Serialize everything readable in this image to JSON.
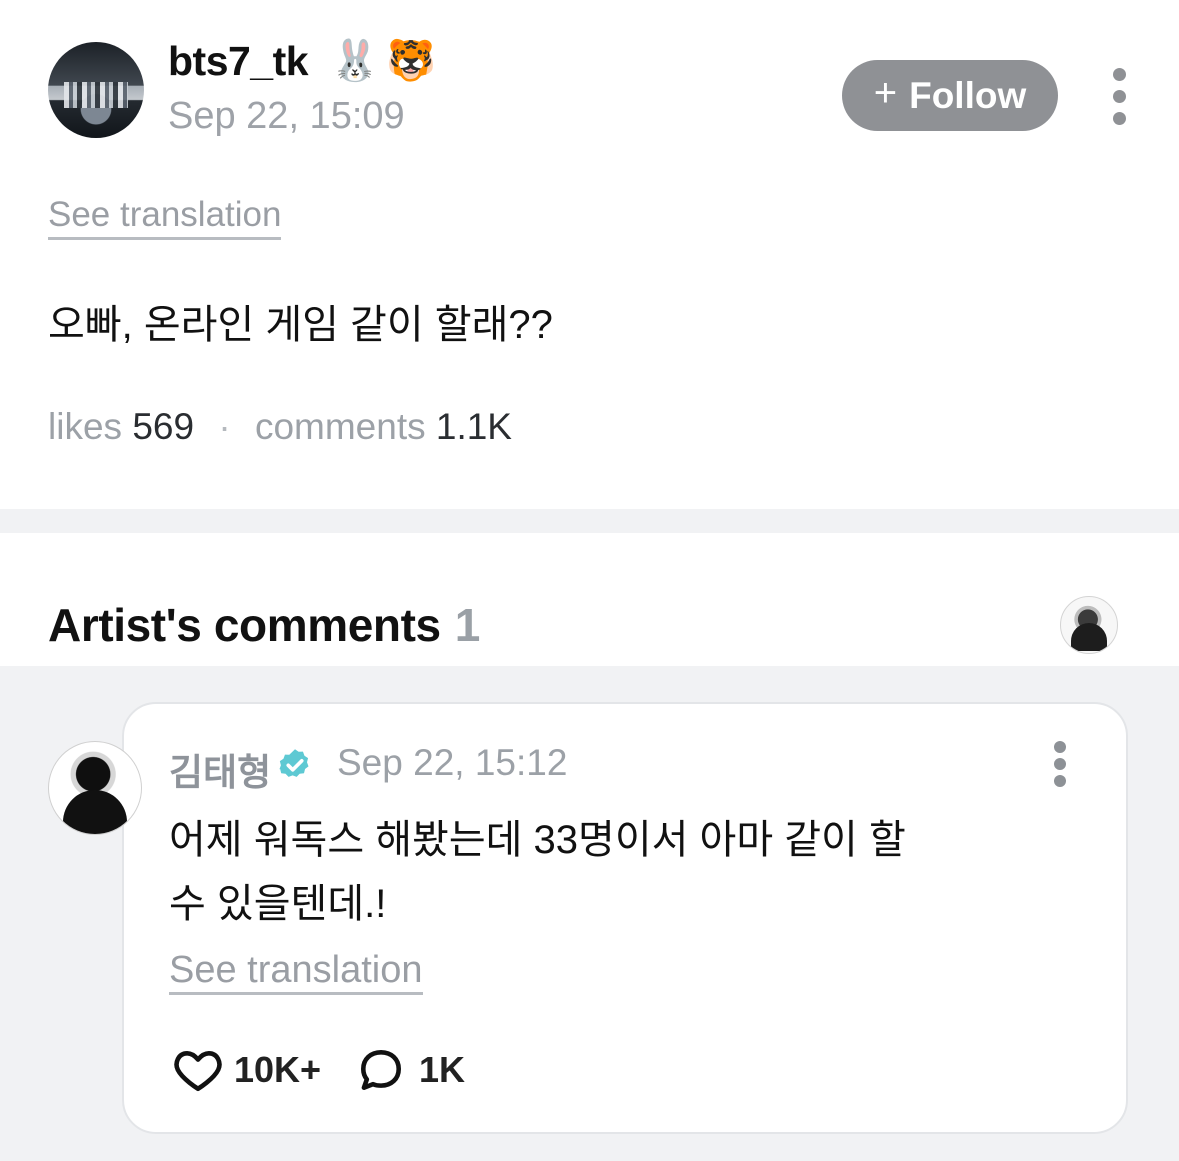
{
  "post": {
    "author": "bts7_tk",
    "emojis": [
      "🐰",
      "🐯"
    ],
    "timestamp": "Sep 22, 15:09",
    "follow_label": "Follow",
    "follow_plus": "+",
    "see_translation": "See translation",
    "text": "오빠, 온라인 게임 같이 할래??",
    "likes_label": "likes",
    "likes_count": "569",
    "separator": "·",
    "comments_label": "comments",
    "comments_count": "1.1K"
  },
  "artist_comments": {
    "title": "Artist's comments",
    "count": "1"
  },
  "comment": {
    "author": "김태형",
    "timestamp": "Sep 22, 15:12",
    "text": "어제 워독스 해봤는데 33명이서 아마 같이 할\n수 있을텐데.!",
    "see_translation": "See translation",
    "likes": "10K+",
    "replies": "1K"
  },
  "icons": {
    "verified": "verified-badge-icon",
    "heart": "heart-icon",
    "reply": "comment-bubble-icon",
    "more": "more-vertical-icon"
  },
  "colors": {
    "follow_button": "#8f9195",
    "verified_badge": "#5ec9d3",
    "section_background": "#f1f2f4"
  }
}
